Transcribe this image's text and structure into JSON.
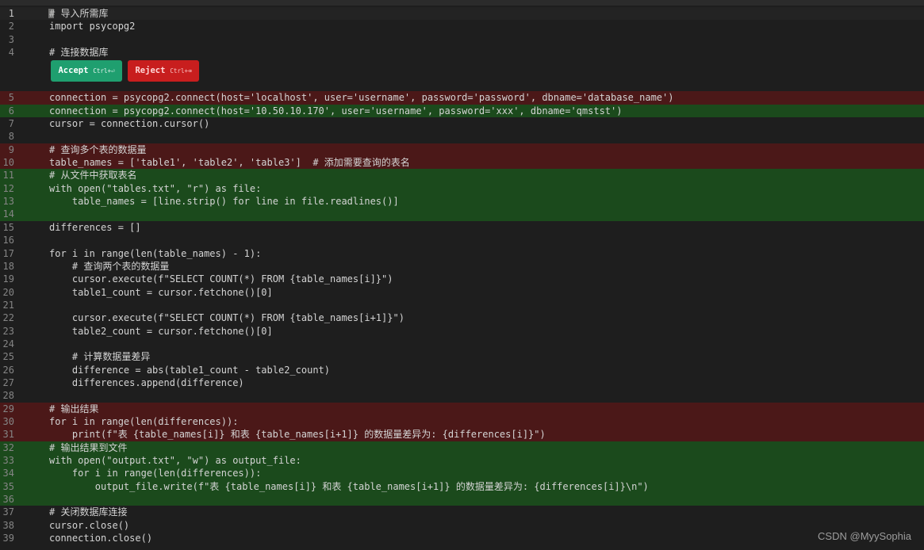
{
  "diff_actions": {
    "accept_label": "Accept",
    "accept_shortcut": "Ctrl+⏎",
    "reject_label": "Reject",
    "reject_shortcut": "Ctrl+⌫"
  },
  "watermark": "CSDN @MyySophia",
  "colors": {
    "editor_bg": "#1e1e1e",
    "deleted_bg": "#4b1818",
    "added_bg": "#1b4a1c",
    "accept_bg": "#1f9f6f",
    "reject_bg": "#c81e1e"
  },
  "lines_before_widget": [
    {
      "num": "1",
      "text": "# 导入所需库",
      "state": "cursor"
    },
    {
      "num": "2",
      "text": "import psycopg2",
      "state": "normal"
    },
    {
      "num": "3",
      "text": "",
      "state": "normal"
    },
    {
      "num": "4",
      "text": "# 连接数据库",
      "state": "normal"
    }
  ],
  "lines_after_widget": [
    {
      "num": "5",
      "text": "connection = psycopg2.connect(host='localhost', user='username', password='password', dbname='database_name')",
      "state": "del"
    },
    {
      "num": "6",
      "text": "connection = psycopg2.connect(host='10.50.10.170', user='username', password='xxx', dbname='qmstst')",
      "state": "add"
    },
    {
      "num": "7",
      "text": "cursor = connection.cursor()",
      "state": "normal"
    },
    {
      "num": "8",
      "text": "",
      "state": "normal"
    },
    {
      "num": "9",
      "text": "# 查询多个表的数据量",
      "state": "del"
    },
    {
      "num": "10",
      "text": "table_names = ['table1', 'table2', 'table3']  # 添加需要查询的表名",
      "state": "del"
    },
    {
      "num": "11",
      "text": "# 从文件中获取表名",
      "state": "add"
    },
    {
      "num": "12",
      "text": "with open(\"tables.txt\", \"r\") as file:",
      "state": "add"
    },
    {
      "num": "13",
      "text": "    table_names = [line.strip() for line in file.readlines()]",
      "state": "add"
    },
    {
      "num": "14",
      "text": "",
      "state": "add"
    },
    {
      "num": "15",
      "text": "differences = []",
      "state": "normal"
    },
    {
      "num": "16",
      "text": "",
      "state": "normal"
    },
    {
      "num": "17",
      "text": "for i in range(len(table_names) - 1):",
      "state": "normal"
    },
    {
      "num": "18",
      "text": "    # 查询两个表的数据量",
      "state": "normal"
    },
    {
      "num": "19",
      "text": "    cursor.execute(f\"SELECT COUNT(*) FROM {table_names[i]}\")",
      "state": "normal"
    },
    {
      "num": "20",
      "text": "    table1_count = cursor.fetchone()[0]",
      "state": "normal"
    },
    {
      "num": "21",
      "text": "",
      "state": "normal"
    },
    {
      "num": "22",
      "text": "    cursor.execute(f\"SELECT COUNT(*) FROM {table_names[i+1]}\")",
      "state": "normal"
    },
    {
      "num": "23",
      "text": "    table2_count = cursor.fetchone()[0]",
      "state": "normal"
    },
    {
      "num": "24",
      "text": "",
      "state": "normal"
    },
    {
      "num": "25",
      "text": "    # 计算数据量差异",
      "state": "normal"
    },
    {
      "num": "26",
      "text": "    difference = abs(table1_count - table2_count)",
      "state": "normal"
    },
    {
      "num": "27",
      "text": "    differences.append(difference)",
      "state": "normal"
    },
    {
      "num": "28",
      "text": "",
      "state": "normal"
    },
    {
      "num": "29",
      "text": "# 输出结果",
      "state": "del"
    },
    {
      "num": "30",
      "text": "for i in range(len(differences)):",
      "state": "del"
    },
    {
      "num": "31",
      "text": "    print(f\"表 {table_names[i]} 和表 {table_names[i+1]} 的数据量差异为: {differences[i]}\")",
      "state": "del"
    },
    {
      "num": "32",
      "text": "# 输出结果到文件",
      "state": "add"
    },
    {
      "num": "33",
      "text": "with open(\"output.txt\", \"w\") as output_file:",
      "state": "add"
    },
    {
      "num": "34",
      "text": "    for i in range(len(differences)):",
      "state": "add"
    },
    {
      "num": "35",
      "text": "        output_file.write(f\"表 {table_names[i]} 和表 {table_names[i+1]} 的数据量差异为: {differences[i]}\\n\")",
      "state": "add"
    },
    {
      "num": "36",
      "text": "",
      "state": "add"
    },
    {
      "num": "37",
      "text": "# 关闭数据库连接",
      "state": "normal"
    },
    {
      "num": "38",
      "text": "cursor.close()",
      "state": "normal"
    },
    {
      "num": "39",
      "text": "connection.close()",
      "state": "normal"
    }
  ]
}
